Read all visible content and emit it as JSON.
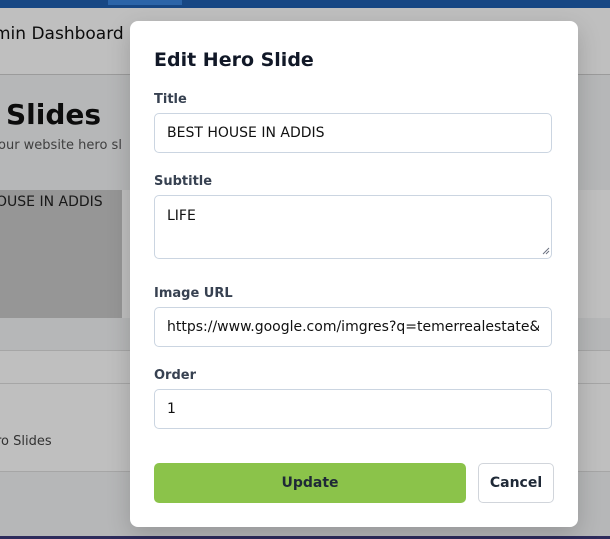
{
  "background": {
    "header_title": "min Dashboard",
    "page_title": "Slides",
    "page_subtitle": "our website hero sl",
    "card_text": "OUSE IN ADDIS",
    "section_text": "ro Slides",
    "topbar_color": "#1f5fb0"
  },
  "modal": {
    "title": "Edit Hero Slide",
    "fields": {
      "title": {
        "label": "Title",
        "value": "BEST HOUSE IN ADDIS"
      },
      "subtitle": {
        "label": "Subtitle",
        "value": "LIFE"
      },
      "image_url": {
        "label": "Image URL",
        "value": "https://www.google.com/imgres?q=temerrealestate&i"
      },
      "order": {
        "label": "Order",
        "value": "1"
      }
    },
    "buttons": {
      "update": "Update",
      "cancel": "Cancel"
    },
    "accent_color": "#8bc34a"
  }
}
